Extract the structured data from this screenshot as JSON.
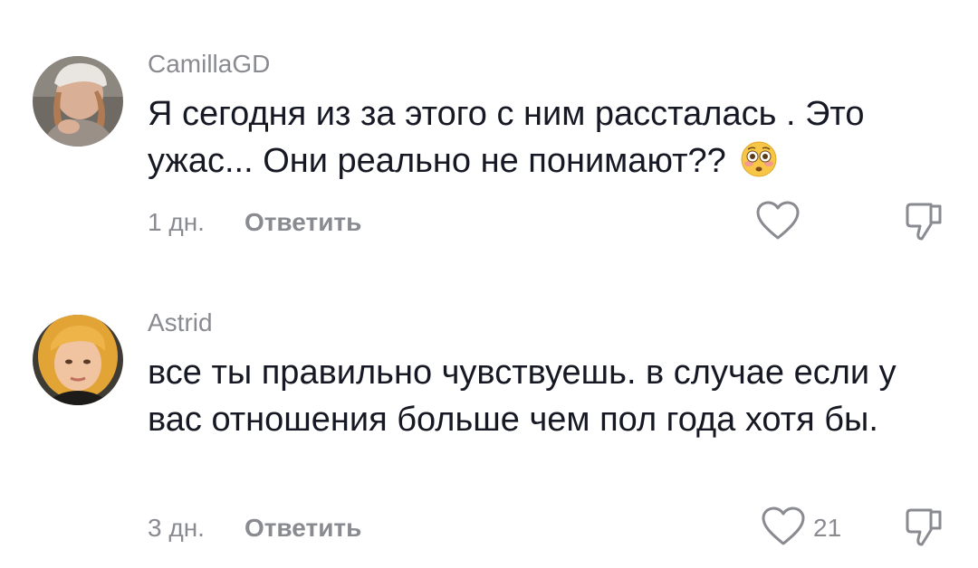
{
  "comments": [
    {
      "username": "CamillaGD",
      "text": "Я сегодня из за этого с ним рассталась . Это ужас... Они реально не понимают??",
      "emoji": "flushed-face",
      "time": "1 дн.",
      "reply_label": "Ответить",
      "like_count": ""
    },
    {
      "username": "Astrid",
      "text": "все ты правильно чувствуешь. в случае если у вас отношения больше чем пол года хотя бы.",
      "time": "3 дн.",
      "reply_label": "Ответить",
      "like_count": "21"
    }
  ],
  "colors": {
    "text": "#161823",
    "muted": "#8a8b91"
  }
}
